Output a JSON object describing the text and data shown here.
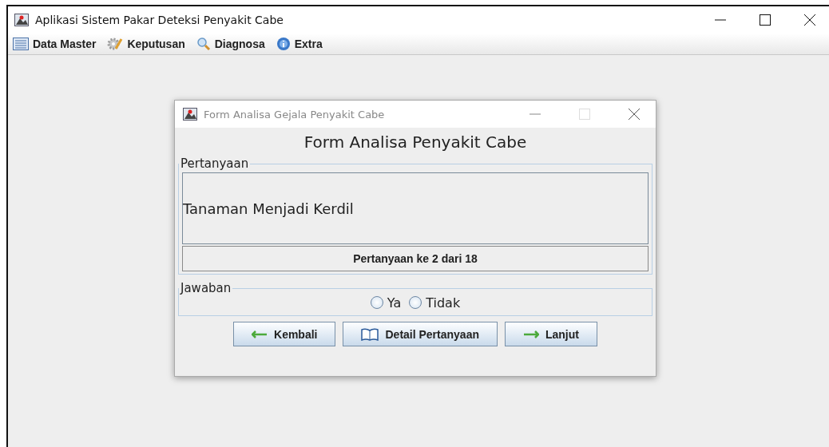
{
  "window": {
    "title": "Aplikasi Sistem Pakar Deteksi Penyakit Cabe"
  },
  "menu": [
    {
      "label": "Data Master",
      "kind": "list"
    },
    {
      "label": "Keputusan",
      "kind": "gear"
    },
    {
      "label": "Diagnosa",
      "kind": "search"
    },
    {
      "label": "Extra",
      "kind": "info"
    }
  ],
  "dialog": {
    "title": "Form Analisa Gejala Penyakit Cabe",
    "heading": "Form Analisa Penyakit Cabe",
    "question_group": {
      "legend": "Pertanyaan",
      "question": "Tanaman Menjadi Kerdil",
      "progress": "Pertanyaan ke 2 dari 18"
    },
    "answer_group": {
      "legend": "Jawaban",
      "options": [
        {
          "label": "Ya",
          "selected": false
        },
        {
          "label": "Tidak",
          "selected": false
        }
      ]
    },
    "buttons": [
      {
        "label": "Kembali",
        "kind": "back"
      },
      {
        "label": "Detail Pertanyaan",
        "kind": "book"
      },
      {
        "label": "Lanjut",
        "kind": "next"
      }
    ]
  }
}
